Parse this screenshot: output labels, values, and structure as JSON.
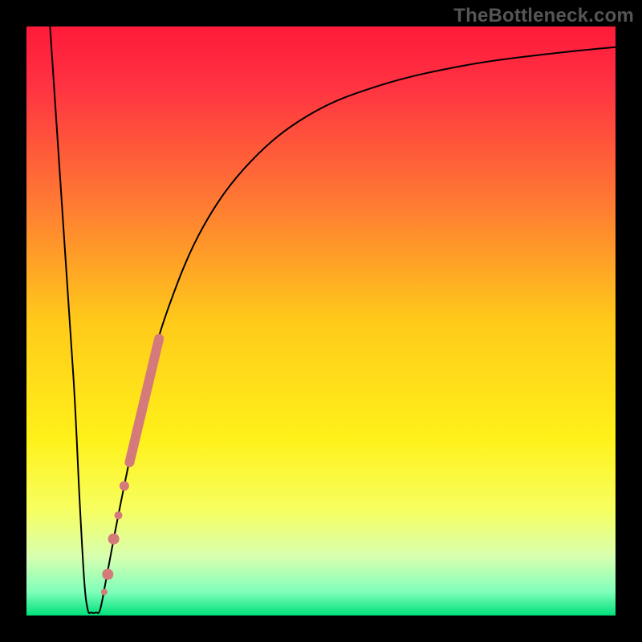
{
  "watermark": "TheBottleneck.com",
  "chart_data": {
    "type": "line",
    "title": "",
    "xlabel": "",
    "ylabel": "",
    "xlim": [
      0,
      100
    ],
    "ylim": [
      0,
      100
    ],
    "grid": false,
    "legend_position": "none",
    "background": {
      "kind": "vertical_gradient",
      "stops": [
        {
          "offset": 0.0,
          "color": "#ff1a3a"
        },
        {
          "offset": 0.1,
          "color": "#ff3242"
        },
        {
          "offset": 0.3,
          "color": "#ff7a33"
        },
        {
          "offset": 0.5,
          "color": "#ffca1a"
        },
        {
          "offset": 0.7,
          "color": "#fff11a"
        },
        {
          "offset": 0.82,
          "color": "#f7ff60"
        },
        {
          "offset": 0.9,
          "color": "#d8ffb0"
        },
        {
          "offset": 0.96,
          "color": "#7fffba"
        },
        {
          "offset": 1.0,
          "color": "#00e07a"
        }
      ]
    },
    "series": [
      {
        "name": "bottleneck-curve",
        "color": "#000000",
        "stroke_width": 2,
        "values": [
          {
            "x": 4.0,
            "y": 100.0
          },
          {
            "x": 6.0,
            "y": 70.0
          },
          {
            "x": 8.0,
            "y": 40.0
          },
          {
            "x": 9.0,
            "y": 20.0
          },
          {
            "x": 9.8,
            "y": 6.0
          },
          {
            "x": 10.4,
            "y": 1.0
          },
          {
            "x": 11.0,
            "y": 0.5
          },
          {
            "x": 11.8,
            "y": 0.5
          },
          {
            "x": 12.5,
            "y": 1.0
          },
          {
            "x": 13.5,
            "y": 6.0
          },
          {
            "x": 15.0,
            "y": 14.0
          },
          {
            "x": 17.0,
            "y": 24.0
          },
          {
            "x": 20.0,
            "y": 38.0
          },
          {
            "x": 24.0,
            "y": 52.0
          },
          {
            "x": 30.0,
            "y": 66.0
          },
          {
            "x": 38.0,
            "y": 77.0
          },
          {
            "x": 48.0,
            "y": 85.0
          },
          {
            "x": 60.0,
            "y": 90.0
          },
          {
            "x": 75.0,
            "y": 93.5
          },
          {
            "x": 90.0,
            "y": 95.5
          },
          {
            "x": 100.0,
            "y": 96.5
          }
        ]
      },
      {
        "name": "highlighted-segment",
        "color": "#d47a7a",
        "stroke_width": 12,
        "linecap": "round",
        "values": [
          {
            "x": 17.5,
            "y": 26.0
          },
          {
            "x": 22.5,
            "y": 47.0
          }
        ]
      }
    ],
    "markers": [
      {
        "name": "dot-1",
        "x": 16.6,
        "y": 22.0,
        "r": 6,
        "color": "#d47a7a"
      },
      {
        "name": "dot-2",
        "x": 15.6,
        "y": 17.0,
        "r": 5,
        "color": "#d47a7a"
      },
      {
        "name": "dot-3",
        "x": 14.8,
        "y": 13.0,
        "r": 7,
        "color": "#d47a7a"
      },
      {
        "name": "dot-4",
        "x": 13.8,
        "y": 7.0,
        "r": 7,
        "color": "#d47a7a"
      },
      {
        "name": "dot-5",
        "x": 13.2,
        "y": 4.0,
        "r": 4,
        "color": "#d47a7a"
      }
    ]
  }
}
